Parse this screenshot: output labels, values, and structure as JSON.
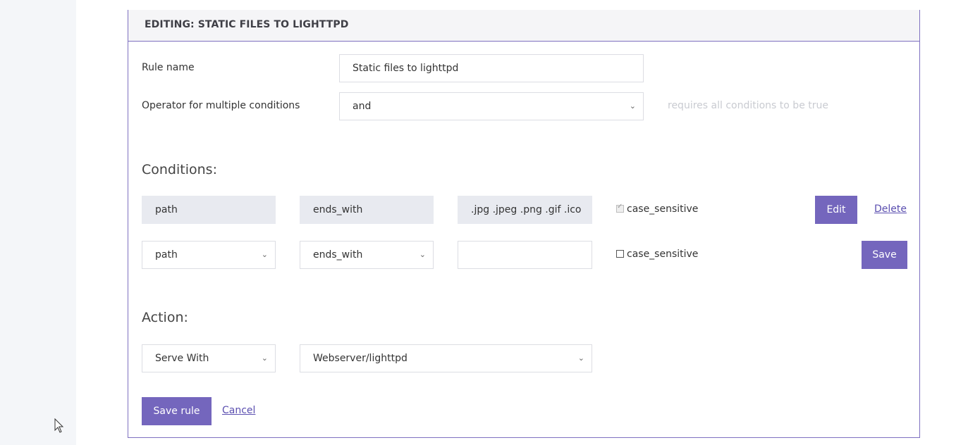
{
  "panel": {
    "title": "EDITING: STATIC FILES TO LIGHTTPD"
  },
  "rule_name": {
    "label": "Rule name",
    "value": "Static files to lighttpd"
  },
  "operator": {
    "label": "Operator for multiple conditions",
    "value": "and",
    "hint": "requires all conditions to be true"
  },
  "conditions": {
    "heading": "Conditions:",
    "existing": {
      "field": "path",
      "operator": "ends_with",
      "value": ".jpg .jpeg .png .gif .ico",
      "case_label": "case_sensitive",
      "case_checked": true,
      "edit_label": "Edit",
      "delete_label": "Delete"
    },
    "new": {
      "field": "path",
      "operator": "ends_with",
      "value": "",
      "case_label": "case_sensitive",
      "case_checked": false,
      "save_label": "Save"
    }
  },
  "action": {
    "heading": "Action:",
    "type": "Serve With",
    "target": "Webserver/lighttpd"
  },
  "footer": {
    "save_label": "Save rule",
    "cancel_label": "Cancel"
  },
  "colors": {
    "accent": "#7466bd",
    "border": "#7e70c0",
    "sidebar": "#f4f6f9"
  },
  "icons": {
    "chevron": "chevron-down-icon",
    "cursor": "mouse-cursor-icon",
    "checkbox": "checkbox-icon"
  }
}
